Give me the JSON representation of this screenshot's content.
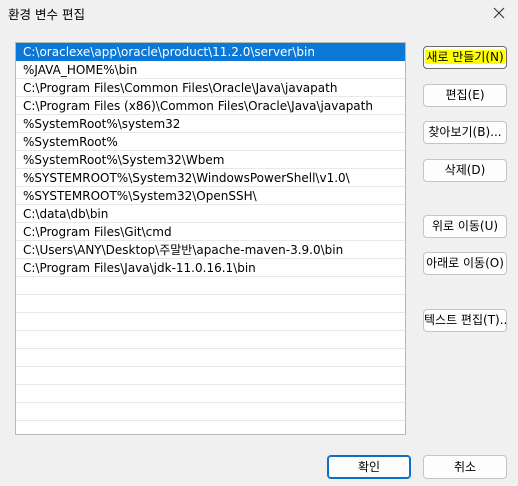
{
  "window": {
    "title": "환경 변수 편집",
    "close_icon": "close-icon"
  },
  "path_list": {
    "items": [
      "C:\\oraclexe\\app\\oracle\\product\\11.2.0\\server\\bin",
      "%JAVA_HOME%\\bin",
      "C:\\Program Files\\Common Files\\Oracle\\Java\\javapath",
      "C:\\Program Files (x86)\\Common Files\\Oracle\\Java\\javapath",
      "%SystemRoot%\\system32",
      "%SystemRoot%",
      "%SystemRoot%\\System32\\Wbem",
      "%SYSTEMROOT%\\System32\\WindowsPowerShell\\v1.0\\",
      "%SYSTEMROOT%\\System32\\OpenSSH\\",
      "C:\\data\\db\\bin",
      "C:\\Program Files\\Git\\cmd",
      "C:\\Users\\ANY\\Desktop\\주말반\\apache-maven-3.9.0\\bin",
      "C:\\Program Files\\Java\\jdk-11.0.16.1\\bin",
      "",
      "",
      "",
      "",
      "",
      "",
      "",
      ""
    ],
    "selected_index": 0
  },
  "side_buttons": {
    "new": "새로 만들기(N)",
    "edit": "편집(E)",
    "browse": "찾아보기(B)...",
    "delete": "삭제(D)",
    "move_up": "위로 이동(U)",
    "move_down": "아래로 이동(O)",
    "edit_text": "텍스트 편집(T)..."
  },
  "footer": {
    "ok": "확인",
    "cancel": "취소"
  },
  "colors": {
    "highlight": "#ffff00",
    "selection": "#0b78d7",
    "background": "#f0f0f0"
  }
}
